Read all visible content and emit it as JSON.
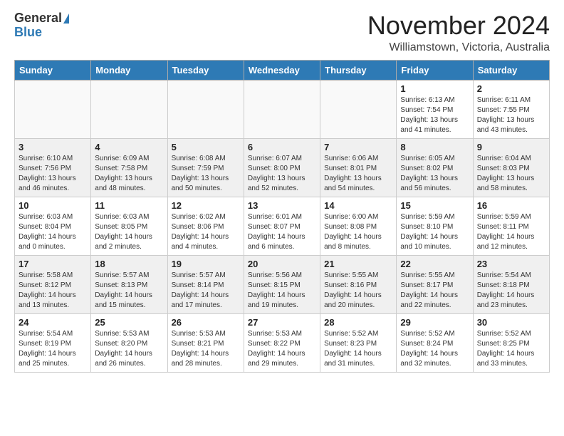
{
  "logo": {
    "general": "General",
    "blue": "Blue"
  },
  "header": {
    "month": "November 2024",
    "location": "Williamstown, Victoria, Australia"
  },
  "days_of_week": [
    "Sunday",
    "Monday",
    "Tuesday",
    "Wednesday",
    "Thursday",
    "Friday",
    "Saturday"
  ],
  "weeks": [
    [
      {
        "day": "",
        "info": ""
      },
      {
        "day": "",
        "info": ""
      },
      {
        "day": "",
        "info": ""
      },
      {
        "day": "",
        "info": ""
      },
      {
        "day": "",
        "info": ""
      },
      {
        "day": "1",
        "info": "Sunrise: 6:13 AM\nSunset: 7:54 PM\nDaylight: 13 hours\nand 41 minutes."
      },
      {
        "day": "2",
        "info": "Sunrise: 6:11 AM\nSunset: 7:55 PM\nDaylight: 13 hours\nand 43 minutes."
      }
    ],
    [
      {
        "day": "3",
        "info": "Sunrise: 6:10 AM\nSunset: 7:56 PM\nDaylight: 13 hours\nand 46 minutes."
      },
      {
        "day": "4",
        "info": "Sunrise: 6:09 AM\nSunset: 7:58 PM\nDaylight: 13 hours\nand 48 minutes."
      },
      {
        "day": "5",
        "info": "Sunrise: 6:08 AM\nSunset: 7:59 PM\nDaylight: 13 hours\nand 50 minutes."
      },
      {
        "day": "6",
        "info": "Sunrise: 6:07 AM\nSunset: 8:00 PM\nDaylight: 13 hours\nand 52 minutes."
      },
      {
        "day": "7",
        "info": "Sunrise: 6:06 AM\nSunset: 8:01 PM\nDaylight: 13 hours\nand 54 minutes."
      },
      {
        "day": "8",
        "info": "Sunrise: 6:05 AM\nSunset: 8:02 PM\nDaylight: 13 hours\nand 56 minutes."
      },
      {
        "day": "9",
        "info": "Sunrise: 6:04 AM\nSunset: 8:03 PM\nDaylight: 13 hours\nand 58 minutes."
      }
    ],
    [
      {
        "day": "10",
        "info": "Sunrise: 6:03 AM\nSunset: 8:04 PM\nDaylight: 14 hours\nand 0 minutes."
      },
      {
        "day": "11",
        "info": "Sunrise: 6:03 AM\nSunset: 8:05 PM\nDaylight: 14 hours\nand 2 minutes."
      },
      {
        "day": "12",
        "info": "Sunrise: 6:02 AM\nSunset: 8:06 PM\nDaylight: 14 hours\nand 4 minutes."
      },
      {
        "day": "13",
        "info": "Sunrise: 6:01 AM\nSunset: 8:07 PM\nDaylight: 14 hours\nand 6 minutes."
      },
      {
        "day": "14",
        "info": "Sunrise: 6:00 AM\nSunset: 8:08 PM\nDaylight: 14 hours\nand 8 minutes."
      },
      {
        "day": "15",
        "info": "Sunrise: 5:59 AM\nSunset: 8:10 PM\nDaylight: 14 hours\nand 10 minutes."
      },
      {
        "day": "16",
        "info": "Sunrise: 5:59 AM\nSunset: 8:11 PM\nDaylight: 14 hours\nand 12 minutes."
      }
    ],
    [
      {
        "day": "17",
        "info": "Sunrise: 5:58 AM\nSunset: 8:12 PM\nDaylight: 14 hours\nand 13 minutes."
      },
      {
        "day": "18",
        "info": "Sunrise: 5:57 AM\nSunset: 8:13 PM\nDaylight: 14 hours\nand 15 minutes."
      },
      {
        "day": "19",
        "info": "Sunrise: 5:57 AM\nSunset: 8:14 PM\nDaylight: 14 hours\nand 17 minutes."
      },
      {
        "day": "20",
        "info": "Sunrise: 5:56 AM\nSunset: 8:15 PM\nDaylight: 14 hours\nand 19 minutes."
      },
      {
        "day": "21",
        "info": "Sunrise: 5:55 AM\nSunset: 8:16 PM\nDaylight: 14 hours\nand 20 minutes."
      },
      {
        "day": "22",
        "info": "Sunrise: 5:55 AM\nSunset: 8:17 PM\nDaylight: 14 hours\nand 22 minutes."
      },
      {
        "day": "23",
        "info": "Sunrise: 5:54 AM\nSunset: 8:18 PM\nDaylight: 14 hours\nand 23 minutes."
      }
    ],
    [
      {
        "day": "24",
        "info": "Sunrise: 5:54 AM\nSunset: 8:19 PM\nDaylight: 14 hours\nand 25 minutes."
      },
      {
        "day": "25",
        "info": "Sunrise: 5:53 AM\nSunset: 8:20 PM\nDaylight: 14 hours\nand 26 minutes."
      },
      {
        "day": "26",
        "info": "Sunrise: 5:53 AM\nSunset: 8:21 PM\nDaylight: 14 hours\nand 28 minutes."
      },
      {
        "day": "27",
        "info": "Sunrise: 5:53 AM\nSunset: 8:22 PM\nDaylight: 14 hours\nand 29 minutes."
      },
      {
        "day": "28",
        "info": "Sunrise: 5:52 AM\nSunset: 8:23 PM\nDaylight: 14 hours\nand 31 minutes."
      },
      {
        "day": "29",
        "info": "Sunrise: 5:52 AM\nSunset: 8:24 PM\nDaylight: 14 hours\nand 32 minutes."
      },
      {
        "day": "30",
        "info": "Sunrise: 5:52 AM\nSunset: 8:25 PM\nDaylight: 14 hours\nand 33 minutes."
      }
    ]
  ]
}
